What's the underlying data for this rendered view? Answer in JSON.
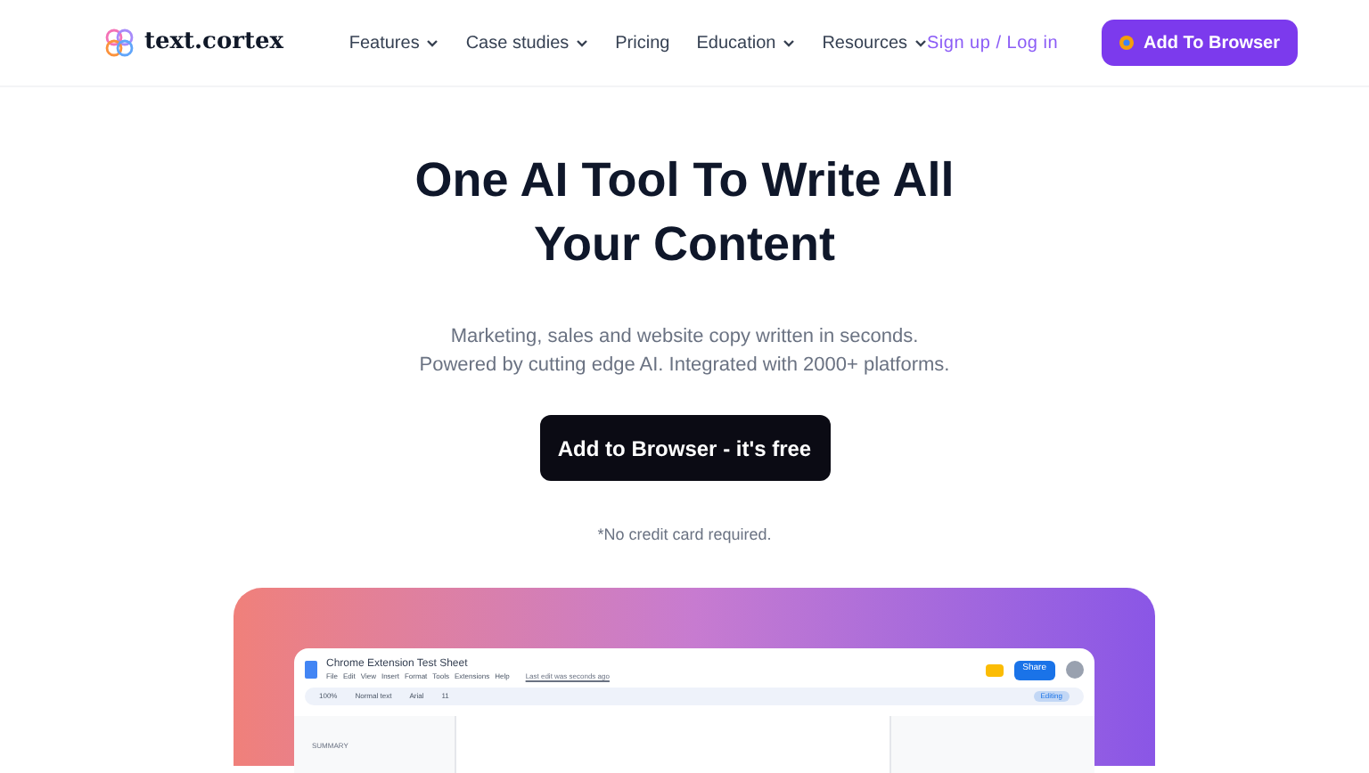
{
  "header": {
    "logo": "text.cortex",
    "nav": [
      {
        "label": "Features",
        "dropdown": true
      },
      {
        "label": "Case studies",
        "dropdown": true
      },
      {
        "label": "Pricing",
        "dropdown": false
      },
      {
        "label": "Education",
        "dropdown": true
      },
      {
        "label": "Resources",
        "dropdown": true
      }
    ],
    "login": "Sign up / Log in",
    "cta": "Add To Browser"
  },
  "hero": {
    "title_lines": [
      "One AI Tool To Write All",
      "Your Content"
    ],
    "subtitle_lines": [
      "Marketing, sales and website copy written in seconds.",
      "Powered by cutting edge AI. Integrated with 2000+ platforms."
    ],
    "button": "Add to Browser - it's free",
    "note": "*No credit card required."
  },
  "doc_preview": {
    "title": "Chrome Extension Test Sheet",
    "menu": [
      "File",
      "Edit",
      "View",
      "Insert",
      "Format",
      "Tools",
      "Extensions",
      "Help"
    ],
    "last_edit": "Last edit was seconds ago",
    "share": "Share",
    "toolbar": [
      "100%",
      "Normal text",
      "Arial",
      "11"
    ],
    "mode": "Editing",
    "outline_label": "SUMMARY"
  }
}
